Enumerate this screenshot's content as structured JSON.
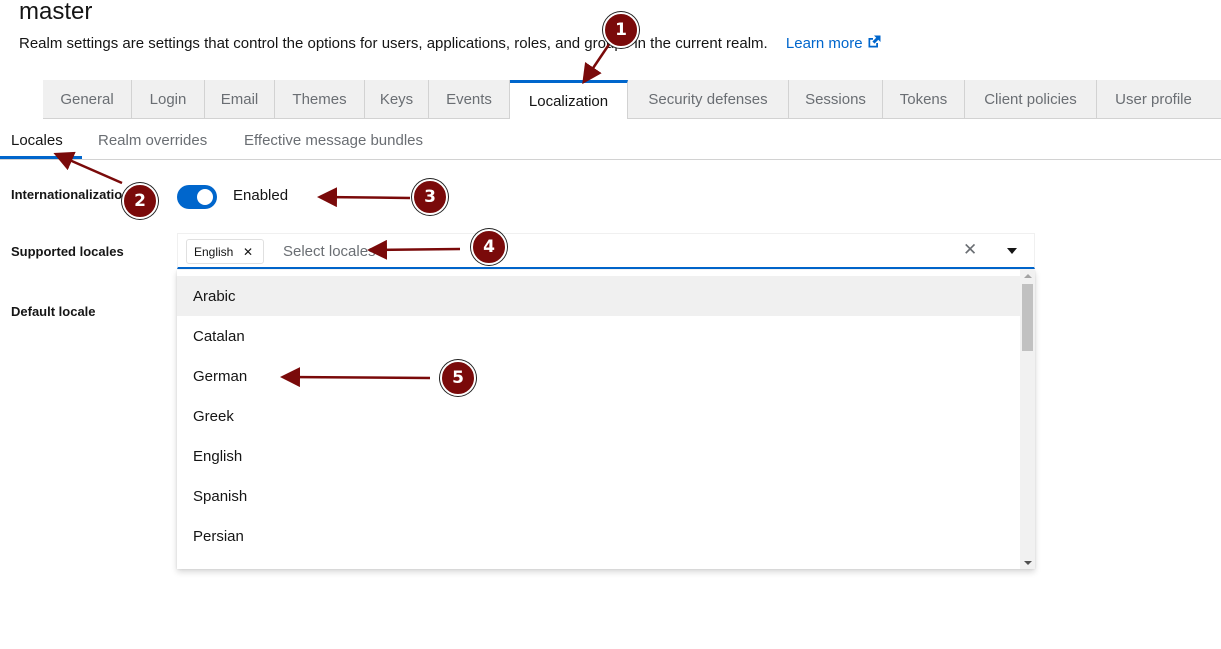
{
  "header": {
    "title": "master",
    "description": "Realm settings are settings that control the options for users, applications, roles, and groups in the current realm.",
    "learn_more": "Learn more",
    "learn_more_icon": "external-link-icon"
  },
  "tabs": [
    {
      "label": "General",
      "active": false
    },
    {
      "label": "Login",
      "active": false
    },
    {
      "label": "Email",
      "active": false
    },
    {
      "label": "Themes",
      "active": false
    },
    {
      "label": "Keys",
      "active": false
    },
    {
      "label": "Events",
      "active": false
    },
    {
      "label": "Localization",
      "active": true
    },
    {
      "label": "Security defenses",
      "active": false
    },
    {
      "label": "Sessions",
      "active": false
    },
    {
      "label": "Tokens",
      "active": false
    },
    {
      "label": "Client policies",
      "active": false
    },
    {
      "label": "User profile",
      "active": false
    }
  ],
  "subtabs": [
    {
      "label": "Locales",
      "active": true
    },
    {
      "label": "Realm overrides",
      "active": false
    },
    {
      "label": "Effective message bundles",
      "active": false
    }
  ],
  "form": {
    "internationalization_label": "Internationalization",
    "internationalization_value": "Enabled",
    "internationalization_on": true,
    "supported_locales_label": "Supported locales",
    "selected_chip": "English",
    "select_placeholder": "Select locales",
    "default_locale_label": "Default locale"
  },
  "dropdown": {
    "options": [
      "Arabic",
      "Catalan",
      "German",
      "Greek",
      "English",
      "Spanish",
      "Persian"
    ],
    "hovered": "Arabic"
  },
  "annotations": [
    "1",
    "2",
    "3",
    "4",
    "5"
  ],
  "colors": {
    "accent": "#0066cc",
    "annotation": "#7a0a0a"
  }
}
